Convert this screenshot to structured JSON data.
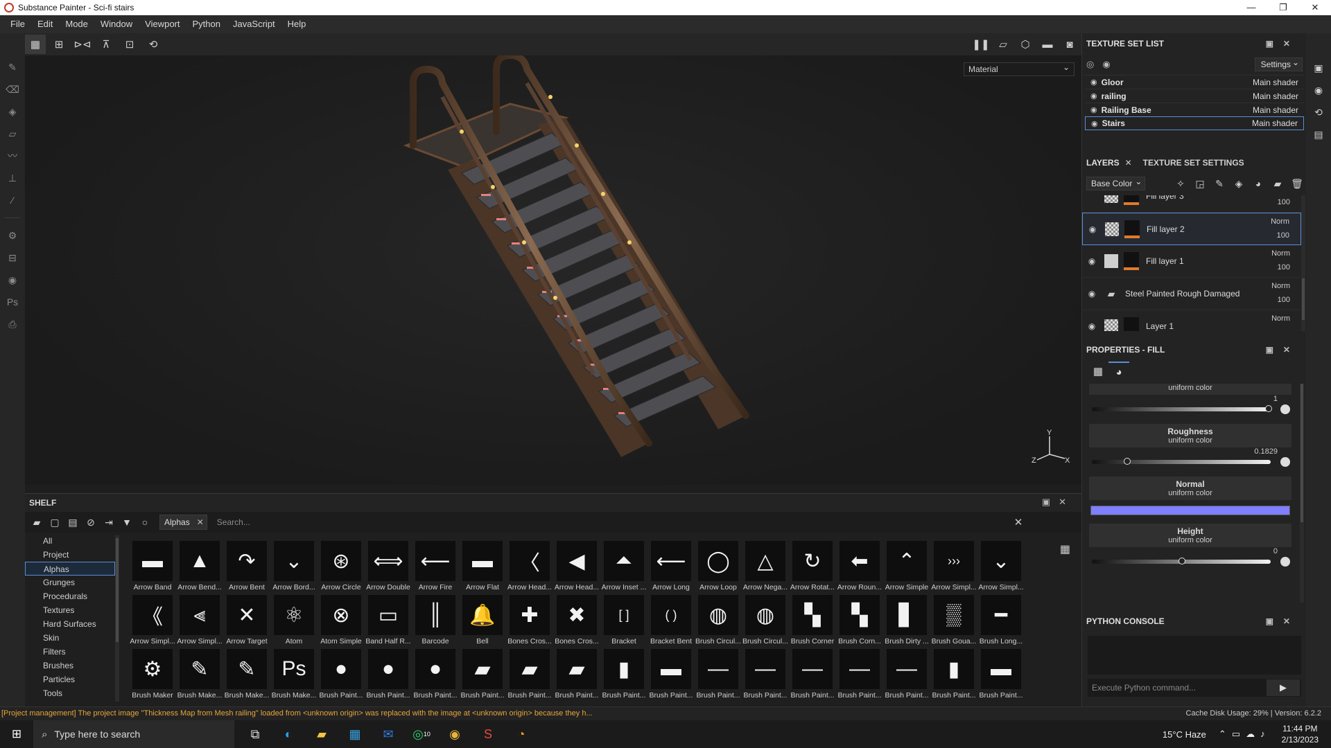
{
  "window": {
    "title": "Substance Painter - Sci-fi stairs",
    "controls": [
      "—",
      "❐",
      "✕"
    ]
  },
  "menu": [
    "File",
    "Edit",
    "Mode",
    "Window",
    "Viewport",
    "Python",
    "JavaScript",
    "Help"
  ],
  "viewport": {
    "material_mode": "Material",
    "gizmo": {
      "y": "Y",
      "z": "Z",
      "x": "X"
    }
  },
  "shelf": {
    "title": "SHELF",
    "filter_chip": "Alphas",
    "search_placeholder": "Search...",
    "categories": [
      "All",
      "Project",
      "Alphas",
      "Grunges",
      "Procedurals",
      "Textures",
      "Hard Surfaces",
      "Skin",
      "Filters",
      "Brushes",
      "Particles",
      "Tools"
    ],
    "selected_category": "Alphas",
    "items": [
      {
        "label": "Arrow Band",
        "glyph": "▬"
      },
      {
        "label": "Arrow Bend...",
        "glyph": "▲"
      },
      {
        "label": "Arrow Bent",
        "glyph": "↷"
      },
      {
        "label": "Arrow Bord...",
        "glyph": "⌄"
      },
      {
        "label": "Arrow Circle",
        "glyph": "⊛"
      },
      {
        "label": "Arrow Double",
        "glyph": "⟺"
      },
      {
        "label": "Arrow Fire",
        "glyph": "⟵"
      },
      {
        "label": "Arrow Flat",
        "glyph": "▬"
      },
      {
        "label": "Arrow Head...",
        "glyph": "〈"
      },
      {
        "label": "Arrow Head...",
        "glyph": "◀"
      },
      {
        "label": "Arrow Inset ...",
        "glyph": "⏶"
      },
      {
        "label": "Arrow Long",
        "glyph": "⟵"
      },
      {
        "label": "Arrow Loop",
        "glyph": "◯"
      },
      {
        "label": "Arrow Nega...",
        "glyph": "△"
      },
      {
        "label": "Arrow Rotat...",
        "glyph": "↻"
      },
      {
        "label": "Arrow Roun...",
        "glyph": "⬅"
      },
      {
        "label": "Arrow Simple",
        "glyph": "⌃"
      },
      {
        "label": "Arrow Simpl...",
        "glyph": "›››"
      },
      {
        "label": "Arrow Simpl...",
        "glyph": "⌄"
      },
      {
        "label": "Arrow Simpl...",
        "glyph": "《"
      },
      {
        "label": "Arrow Simpl...",
        "glyph": "⫷"
      },
      {
        "label": "Arrow Target",
        "glyph": "✕"
      },
      {
        "label": "Atom",
        "glyph": "⚛"
      },
      {
        "label": "Atom Simple",
        "glyph": "⊗"
      },
      {
        "label": "Band Half R...",
        "glyph": "▭"
      },
      {
        "label": "Barcode",
        "glyph": "║"
      },
      {
        "label": "Bell",
        "glyph": "🔔"
      },
      {
        "label": "Bones Cros...",
        "glyph": "✚"
      },
      {
        "label": "Bones Cros...",
        "glyph": "✖"
      },
      {
        "label": "Bracket",
        "glyph": "[ ]"
      },
      {
        "label": "Bracket Bent",
        "glyph": "( )"
      },
      {
        "label": "Brush Circul...",
        "glyph": "◍"
      },
      {
        "label": "Brush Circul...",
        "glyph": "◍"
      },
      {
        "label": "Brush Corner",
        "glyph": "▚"
      },
      {
        "label": "Brush Corn...",
        "glyph": "▚"
      },
      {
        "label": "Brush Dirty ...",
        "glyph": "▋"
      },
      {
        "label": "Brush Goua...",
        "glyph": "▒"
      },
      {
        "label": "Brush Long...",
        "glyph": "━"
      },
      {
        "label": "Brush Maker",
        "glyph": "⚙"
      },
      {
        "label": "Brush Make...",
        "glyph": "✎"
      },
      {
        "label": "Brush Make...",
        "glyph": "✎"
      },
      {
        "label": "Brush Make...",
        "glyph": "Ps"
      },
      {
        "label": "Brush Paint...",
        "glyph": "●"
      },
      {
        "label": "Brush Paint...",
        "glyph": "●"
      },
      {
        "label": "Brush Paint...",
        "glyph": "●"
      },
      {
        "label": "Brush Paint...",
        "glyph": "▰"
      },
      {
        "label": "Brush Paint...",
        "glyph": "▰"
      },
      {
        "label": "Brush Paint...",
        "glyph": "▰"
      },
      {
        "label": "Brush Paint...",
        "glyph": "▮"
      },
      {
        "label": "Brush Paint...",
        "glyph": "▬"
      },
      {
        "label": "Brush Paint...",
        "glyph": "—"
      },
      {
        "label": "Brush Paint...",
        "glyph": "—"
      },
      {
        "label": "Brush Paint...",
        "glyph": "—"
      },
      {
        "label": "Brush Paint...",
        "glyph": "—"
      },
      {
        "label": "Brush Paint...",
        "glyph": "—"
      },
      {
        "label": "Brush Paint...",
        "glyph": "▮"
      },
      {
        "label": "Brush Paint...",
        "glyph": "▬"
      }
    ]
  },
  "texture_set_list": {
    "title": "TEXTURE SET LIST",
    "settings_label": "Settings",
    "rows": [
      {
        "name": "Gloor",
        "shader": "Main shader"
      },
      {
        "name": "railing",
        "shader": "Main shader"
      },
      {
        "name": "Railing Base",
        "shader": "Main shader"
      },
      {
        "name": "Stairs",
        "shader": "Main shader"
      }
    ]
  },
  "layers": {
    "tab_layers": "LAYERS",
    "tab_settings": "TEXTURE SET SETTINGS",
    "channel": "Base Color",
    "rows": [
      {
        "name": "Fill layer 3",
        "blend": "",
        "opacity": "100",
        "thumb": "checker"
      },
      {
        "name": "Fill layer 2",
        "blend": "Norm",
        "opacity": "100",
        "thumb": "checker"
      },
      {
        "name": "Fill layer 1",
        "blend": "Norm",
        "opacity": "100",
        "thumb": "plain"
      },
      {
        "name": "Steel Painted Rough Damaged",
        "blend": "Norm",
        "opacity": "100",
        "thumb": "folder"
      },
      {
        "name": "Layer 1",
        "blend": "Norm",
        "opacity": "",
        "thumb": "checker"
      }
    ]
  },
  "properties": {
    "title": "PROPERTIES - FILL",
    "top_label": "uniform color",
    "top_slider_value": "1",
    "top_slider_fraction": 1.0,
    "roughness": {
      "title": "Roughness",
      "sub": "uniform color",
      "value": "0.1829",
      "fraction": 0.1829
    },
    "normal": {
      "title": "Normal",
      "sub": "uniform color",
      "color": "#7f7fff"
    },
    "height": {
      "title": "Height",
      "sub": "uniform color",
      "value": "0",
      "fraction": 0.5
    }
  },
  "python_console": {
    "title": "PYTHON CONSOLE",
    "placeholder": "Execute Python command...",
    "run": "▶"
  },
  "status": {
    "message": "[Project management] The project image \"Thickness Map from Mesh railing\" loaded from <unknown origin> was replaced with the image at <unknown origin> because they h...",
    "cache": "Cache Disk Usage:   29% | Version: 6.2.2"
  },
  "taskbar": {
    "search_placeholder": "Type here to search",
    "weather": "15°C  Haze",
    "time": "11:44 PM",
    "date": "2/13/2023",
    "whatsapp_badge": "10"
  }
}
